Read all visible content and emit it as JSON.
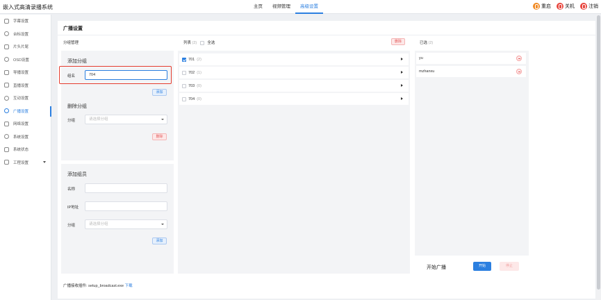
{
  "app": {
    "title": "嵌入式高清录播系统"
  },
  "topnav": [
    {
      "label": "主页"
    },
    {
      "label": "视频管理"
    },
    {
      "label": "高级设置",
      "active": true
    }
  ],
  "topactions": {
    "restart": "重启",
    "shutdown": "关机",
    "logout": "注销"
  },
  "sidebar": [
    {
      "label": "字幕设置",
      "icon": "subtitle-icon"
    },
    {
      "label": "台标设置",
      "icon": "logo-icon"
    },
    {
      "label": "片头片尾",
      "icon": "film-icon"
    },
    {
      "label": "OSD设置",
      "icon": "osd-icon"
    },
    {
      "label": "导播设置",
      "icon": "director-icon"
    },
    {
      "label": "直播设置",
      "icon": "live-icon"
    },
    {
      "label": "互动设置",
      "icon": "interact-icon"
    },
    {
      "label": "广播设置",
      "icon": "broadcast-icon",
      "active": true
    },
    {
      "label": "网络设置",
      "icon": "network-icon"
    },
    {
      "label": "系统设置",
      "icon": "system-icon"
    },
    {
      "label": "系统状态",
      "icon": "status-icon"
    },
    {
      "label": "工程设置",
      "icon": "project-icon"
    }
  ],
  "panel": {
    "title": "广播设置",
    "group_manage": "分组管理",
    "add_group": {
      "heading": "添加分组",
      "name_label": "组名",
      "name_value": "704",
      "add_button": "添加"
    },
    "delete_group": {
      "heading": "删除分组",
      "group_label": "分组",
      "placeholder": "请选择分组",
      "delete_button": "删除"
    },
    "add_member": {
      "heading": "添加组员",
      "name_label": "名称",
      "ip_label": "IP地址",
      "group_label": "分组",
      "group_placeholder": "请选择分组",
      "add_button": "添加"
    },
    "list": {
      "label": "列表",
      "count": "(2)",
      "select_all": "全选",
      "delete_button": "删除",
      "rows": [
        {
          "name": "701",
          "count": "(2)",
          "checked": true
        },
        {
          "name": "702",
          "count": "(1)",
          "checked": false
        },
        {
          "name": "703",
          "count": "(0)",
          "checked": false
        },
        {
          "name": "704",
          "count": "(0)",
          "checked": false
        }
      ]
    },
    "selected": {
      "label": "已选",
      "count": "(2)",
      "items": [
        "yu",
        "mzhanxu"
      ]
    },
    "broadcast": {
      "label": "开始广播",
      "start": "开始",
      "stop": "停止"
    },
    "footer": {
      "text": "广播接收插件: setup_broadcast.exe",
      "download": "下载"
    }
  },
  "colors": {
    "accent": "#2b7fe0",
    "danger": "#e53c2e",
    "orange": "#f08a24"
  }
}
